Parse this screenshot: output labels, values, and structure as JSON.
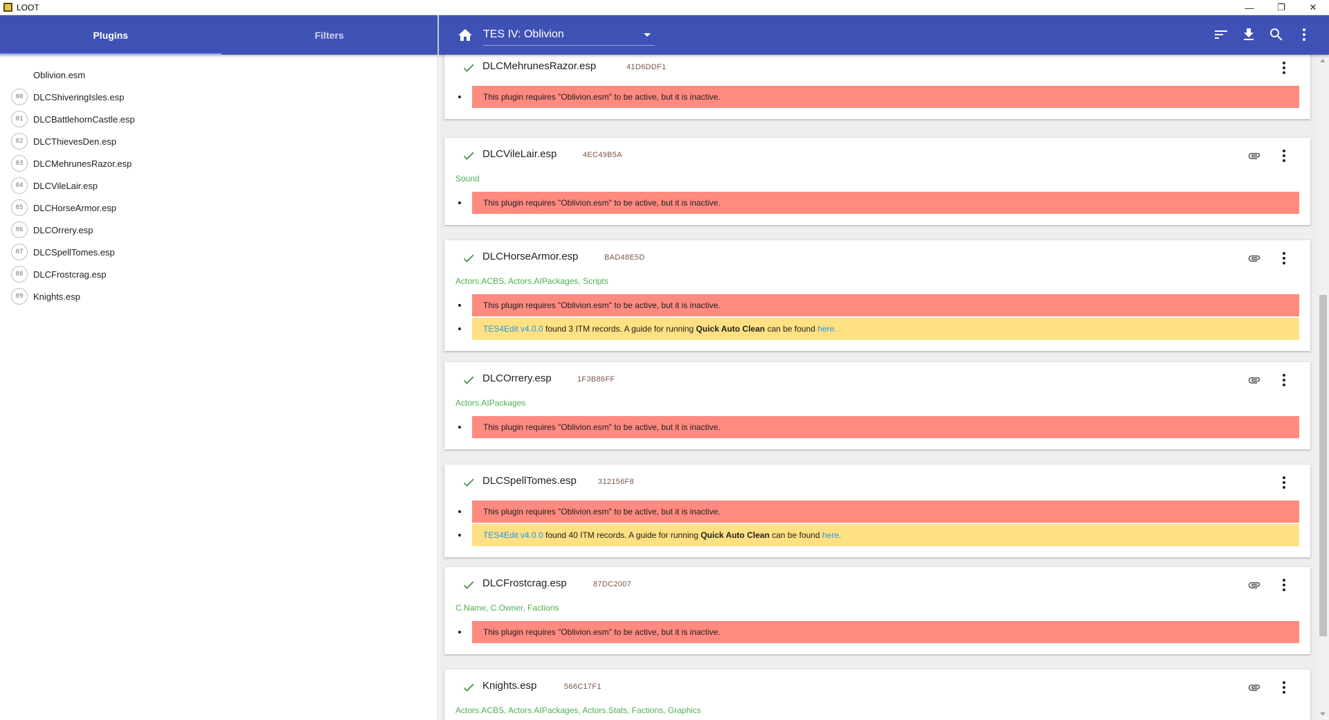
{
  "window": {
    "title": "LOOT",
    "minimize": "—",
    "restore": "❐",
    "close": "✕"
  },
  "sidebar": {
    "tabs": [
      {
        "label": "Plugins",
        "active": true
      },
      {
        "label": "Filters",
        "active": false
      }
    ],
    "items": [
      {
        "index": "",
        "name": "Oblivion.esm"
      },
      {
        "index": "00",
        "name": "DLCShiveringIsles.esp"
      },
      {
        "index": "01",
        "name": "DLCBattlehornCastle.esp"
      },
      {
        "index": "02",
        "name": "DLCThievesDen.esp"
      },
      {
        "index": "03",
        "name": "DLCMehrunesRazor.esp"
      },
      {
        "index": "04",
        "name": "DLCVileLair.esp"
      },
      {
        "index": "05",
        "name": "DLCHorseArmor.esp"
      },
      {
        "index": "06",
        "name": "DLCOrrery.esp"
      },
      {
        "index": "07",
        "name": "DLCSpellTomes.esp"
      },
      {
        "index": "08",
        "name": "DLCFrostcrag.esp"
      },
      {
        "index": "09",
        "name": "Knights.esp"
      }
    ]
  },
  "header": {
    "game": "TES IV: Oblivion",
    "icons": [
      "home-icon",
      "sort-icon",
      "download-icon",
      "search-icon",
      "more-vert-icon"
    ]
  },
  "messages": {
    "inactive": "This plugin requires \"Oblivion.esm\" to be active, but it is inactive.",
    "itm_tool": "TES4Edit v4.0.0",
    "itm_found_prefix": " found ",
    "itm_found_suffix": " ITM records. A guide for running ",
    "itm_guide_bold": "Quick Auto Clean",
    "itm_guide_mid": " can be found ",
    "itm_link": "here",
    "itm_end": "."
  },
  "cards": [
    {
      "name": "DLCMehrunesRazor.esp",
      "crc": "41D6DDF1",
      "tags": "",
      "has_clip": false
    },
    {
      "name": "DLCVileLair.esp",
      "crc": "4EC49B5A",
      "tags": "Sound",
      "has_clip": true
    },
    {
      "name": "DLCHorseArmor.esp",
      "crc": "BAD48E5D",
      "tags": "Actors.ACBS, Actors.AIPackages, Scripts",
      "has_clip": true,
      "itm_count": "3"
    },
    {
      "name": "DLCOrrery.esp",
      "crc": "1F3B86FF",
      "tags": "Actors.AIPackages",
      "has_clip": true
    },
    {
      "name": "DLCSpellTomes.esp",
      "crc": "312156F8",
      "tags": "",
      "has_clip": false,
      "itm_count": "40"
    },
    {
      "name": "DLCFrostcrag.esp",
      "crc": "87DC2007",
      "tags": "C.Name, C.Owner, Factions",
      "has_clip": true
    },
    {
      "name": "Knights.esp",
      "crc": "566C17F1",
      "tags": "Actors.ACBS, Actors.AIPackages, Actors.Stats, Factions, Graphics",
      "has_clip": true
    }
  ],
  "colors": {
    "primary": "#3f51b5",
    "error_bg": "#ff8a80",
    "warn_bg": "#ffe082",
    "tag_green": "#4caf50",
    "link_blue": "#2196f3"
  }
}
